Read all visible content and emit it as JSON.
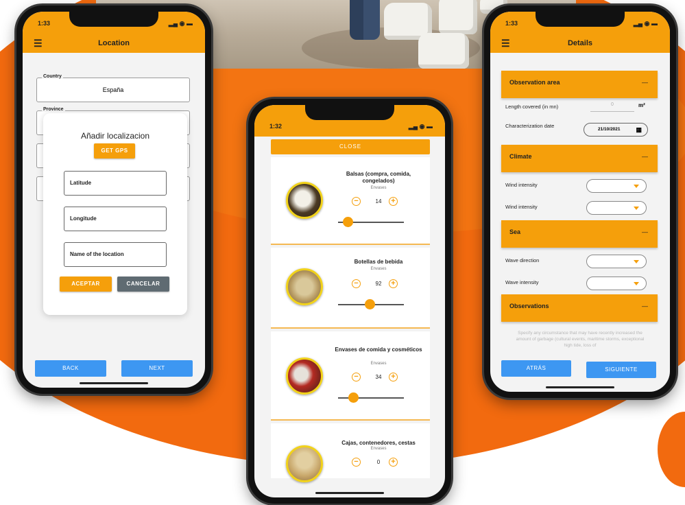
{
  "colors": {
    "accent": "#f59f0b",
    "background_orange": "#f26a0f",
    "primary_blue": "#3d97f2",
    "cancel_grey": "#5f6b72"
  },
  "phone_location": {
    "status_time": "1:33",
    "status_icons": "signal-wifi-battery-icons",
    "menu_icon": "menu-icon",
    "title": "Location",
    "country_label": "Country",
    "country_value": "España",
    "province_label": "Province",
    "dialog": {
      "title": "Añadir localizacion",
      "gps_button": "GET GPS",
      "latitude_placeholder": "Latitude",
      "longitude_placeholder": "Longitude",
      "name_placeholder": "Name of the location",
      "accept_button": "ACEPTAR",
      "cancel_button": "CANCELAR"
    },
    "back_button": "BACK",
    "next_button": "NEXT"
  },
  "phone_items": {
    "status_time": "1:32",
    "status_icons": "signal-wifi-battery-icons",
    "close_button": "CLOSE",
    "items": [
      {
        "title": "Balsas (compra, comida, congelados)",
        "category": "Envases",
        "count": "14",
        "level": 0.15
      },
      {
        "title": "Botellas de bebida",
        "category": "Envases",
        "count": "92",
        "level": 0.48
      },
      {
        "title": "Envases de comida y cosméticos",
        "category": "Envases",
        "count": "34",
        "level": 0.23
      },
      {
        "title": "Cajas, contenedores, cestas",
        "category": "Envases",
        "count": "0",
        "level": 0
      }
    ],
    "minus_icon": "minus-circle-icon",
    "plus_icon": "plus-circle-icon"
  },
  "phone_details": {
    "status_time": "1:33",
    "status_icons": "signal-wifi-battery-icons",
    "menu_icon": "menu-icon",
    "title": "Details",
    "sections": {
      "observation_area": "Observation area",
      "climate": "Climate",
      "sea": "Sea",
      "observations": "Observations"
    },
    "collapse_symbol": "—",
    "length_label": "Length covered (in mn)",
    "length_value": "0",
    "length_unit": "m²",
    "char_date_label": "Characterization date",
    "char_date_value": "21/10/2021",
    "wind_intensity_label_1": "Wind intensity",
    "wind_intensity_label_2": "Wind intensity",
    "wave_direction_label": "Wave direction",
    "wave_intensity_label": "Wave intensity",
    "observations_placeholder": "Specify any circumstance that may have recently increased the amount of garbage (cultural events, maritime storms, exceptional high tide, loss of",
    "back_button": "ATRÁS",
    "next_button": "SIGUIENTE"
  }
}
